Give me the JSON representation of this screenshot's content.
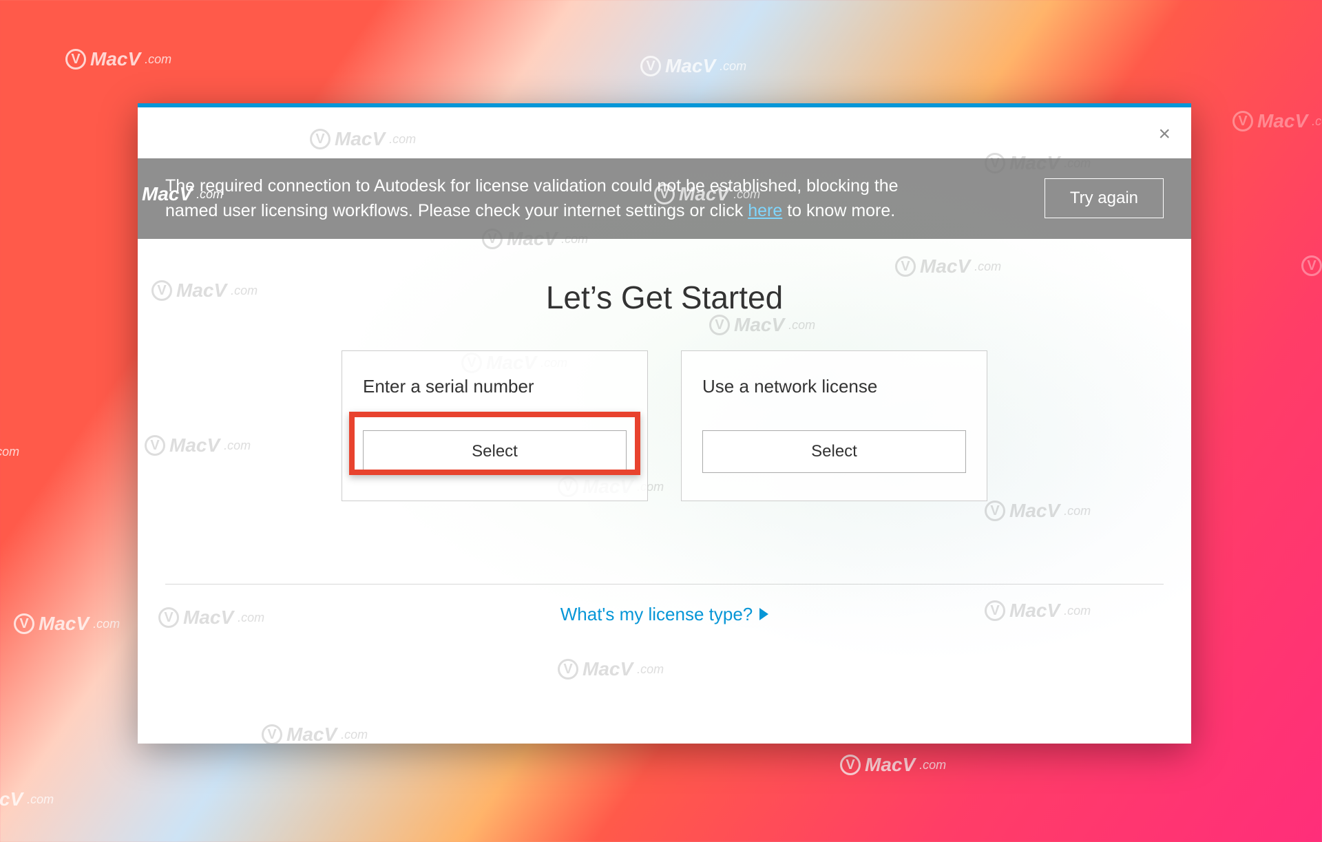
{
  "watermark": {
    "brand": "MacV",
    "suffix": ".com"
  },
  "dialog": {
    "close_label": "×",
    "warning": {
      "text_before_link": "The required connection to Autodesk for license validation could not be established, blocking the named user licensing workflows. Please check your internet settings or click ",
      "link_text": "here",
      "text_after_link": " to know more.",
      "try_again_label": "Try again"
    },
    "title": "Let’s Get Started",
    "cards": [
      {
        "title": "Enter a serial number",
        "button": "Select",
        "highlighted": true
      },
      {
        "title": "Use a network license",
        "button": "Select",
        "highlighted": false
      }
    ],
    "footer_link": "What's my license type?"
  }
}
